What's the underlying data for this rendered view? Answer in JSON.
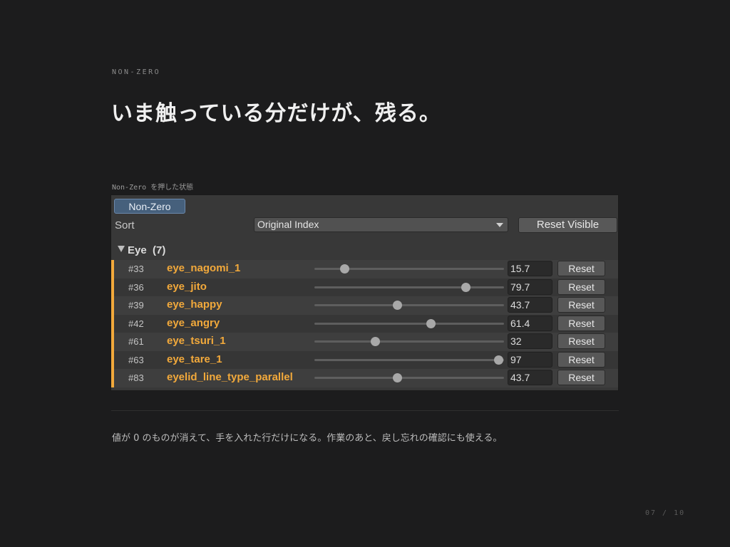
{
  "eyebrow": "NON-ZERO",
  "headline": "いま触っている分だけが、残る。",
  "caption": "Non-Zero を押した状態",
  "panel": {
    "toggle_label": "Non-Zero",
    "sort_label": "Sort",
    "sort_value": "Original Index",
    "reset_visible_label": "Reset Visible",
    "group_label": "Eye",
    "group_count": "(7)",
    "reset_label": "Reset",
    "rows": [
      {
        "index": "#33",
        "name": "eye_nagomi_1",
        "value": "15.7",
        "level": 0.157
      },
      {
        "index": "#36",
        "name": "eye_jito",
        "value": "79.7",
        "level": 0.797
      },
      {
        "index": "#39",
        "name": "eye_happy",
        "value": "43.7",
        "level": 0.437
      },
      {
        "index": "#42",
        "name": "eye_angry",
        "value": "61.4",
        "level": 0.614
      },
      {
        "index": "#61",
        "name": "eye_tsuri_1",
        "value": "32",
        "level": 0.32
      },
      {
        "index": "#63",
        "name": "eye_tare_1",
        "value": "97",
        "level": 0.97
      },
      {
        "index": "#83",
        "name": "eyelid_line_type_parallel",
        "value": "43.7",
        "level": 0.437
      }
    ]
  },
  "footnote": "値が 0 のものが消えて、手を入れた行だけになる。作業のあと、戻し忘れの確認にも使える。",
  "page": "07 / 10",
  "colors": {
    "accent": "#f2a93b",
    "toggle": "#46607c",
    "background": "#1c1c1d"
  }
}
